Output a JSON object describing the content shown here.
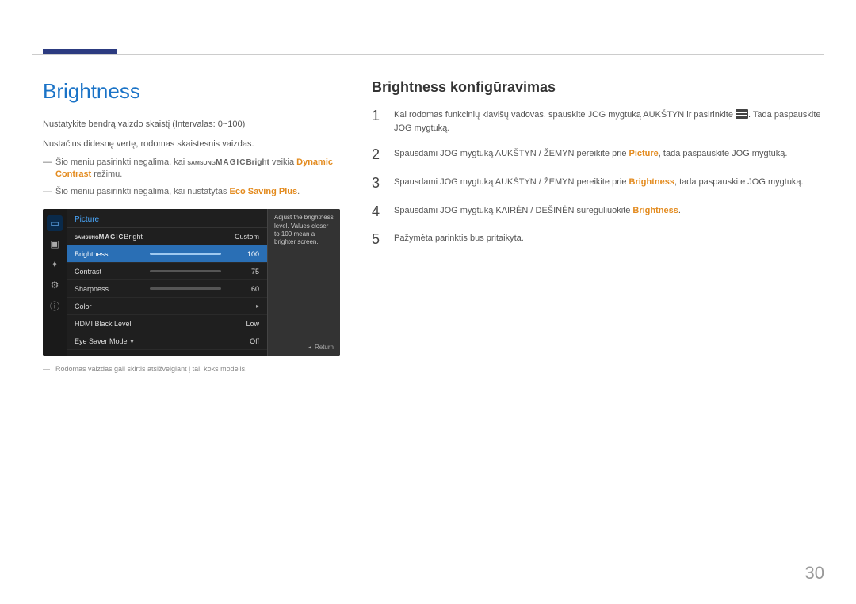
{
  "page_number": "30",
  "left": {
    "title": "Brightness",
    "intro1": "Nustatykite bendrą vaizdo skaistį (Intervalas: 0~100)",
    "intro2": "Nustačius didesnę vertę, rodomas skaistesnis vaizdas.",
    "note1_pre": "Šio meniu pasirinkti negalima, kai ",
    "note1_magic_brand": "SAMSUNG",
    "note1_magic": "MAGIC",
    "note1_bright": "Bright",
    "note1_mid": " veikia ",
    "note1_hl": "Dynamic Contrast",
    "note1_post": " režimu.",
    "note2_pre": "Šio meniu pasirinkti negalima, kai nustatytas ",
    "note2_hl": "Eco Saving Plus",
    "note2_post": ".",
    "footnote": "Rodomas vaizdas gali skirtis atsižvelgiant į tai, koks modelis."
  },
  "osd": {
    "title": "Picture",
    "rows": [
      {
        "label_prefix_brand": "SAMSUNG",
        "label_prefix": "MAGIC",
        "label": "Bright",
        "value": "Custom",
        "type": "text"
      },
      {
        "label": "Brightness",
        "value": "100",
        "type": "slider",
        "fill": 100,
        "selected": true
      },
      {
        "label": "Contrast",
        "value": "75",
        "type": "slider",
        "fill": 75
      },
      {
        "label": "Sharpness",
        "value": "60",
        "type": "slider",
        "fill": 60
      },
      {
        "label": "Color",
        "value": "▸",
        "type": "arrow"
      },
      {
        "label": "HDMI Black Level",
        "value": "Low",
        "type": "text"
      },
      {
        "label": "Eye Saver Mode",
        "value": "Off",
        "type": "text",
        "has_down": true
      }
    ],
    "help": "Adjust the brightness level. Values closer to 100 mean a brighter screen.",
    "return": "Return"
  },
  "right": {
    "title": "Brightness konfigūravimas",
    "steps": [
      {
        "n": "1",
        "pre": "Kai rodomas funkcinių klavišų vadovas, spauskite JOG mygtuką AUKŠTYN ir pasirinkite ",
        "icon": true,
        "post": ". Tada paspauskite JOG mygtuką."
      },
      {
        "n": "2",
        "full_pre": "Spausdami JOG mygtuką AUKŠTYN / ŽEMYN pereikite prie ",
        "hl": "Picture",
        "full_post": ", tada paspauskite JOG mygtuką."
      },
      {
        "n": "3",
        "full_pre": "Spausdami JOG mygtuką AUKŠTYN / ŽEMYN pereikite prie ",
        "hl": "Brightness",
        "full_post": ", tada paspauskite JOG mygtuką."
      },
      {
        "n": "4",
        "full_pre": "Spausdami JOG mygtuką KAIRĖN / DEŠINĖN sureguliuokite ",
        "hl": "Brightness",
        "full_post": "."
      },
      {
        "n": "5",
        "plain": "Pažymėta parinktis bus pritaikyta."
      }
    ]
  }
}
